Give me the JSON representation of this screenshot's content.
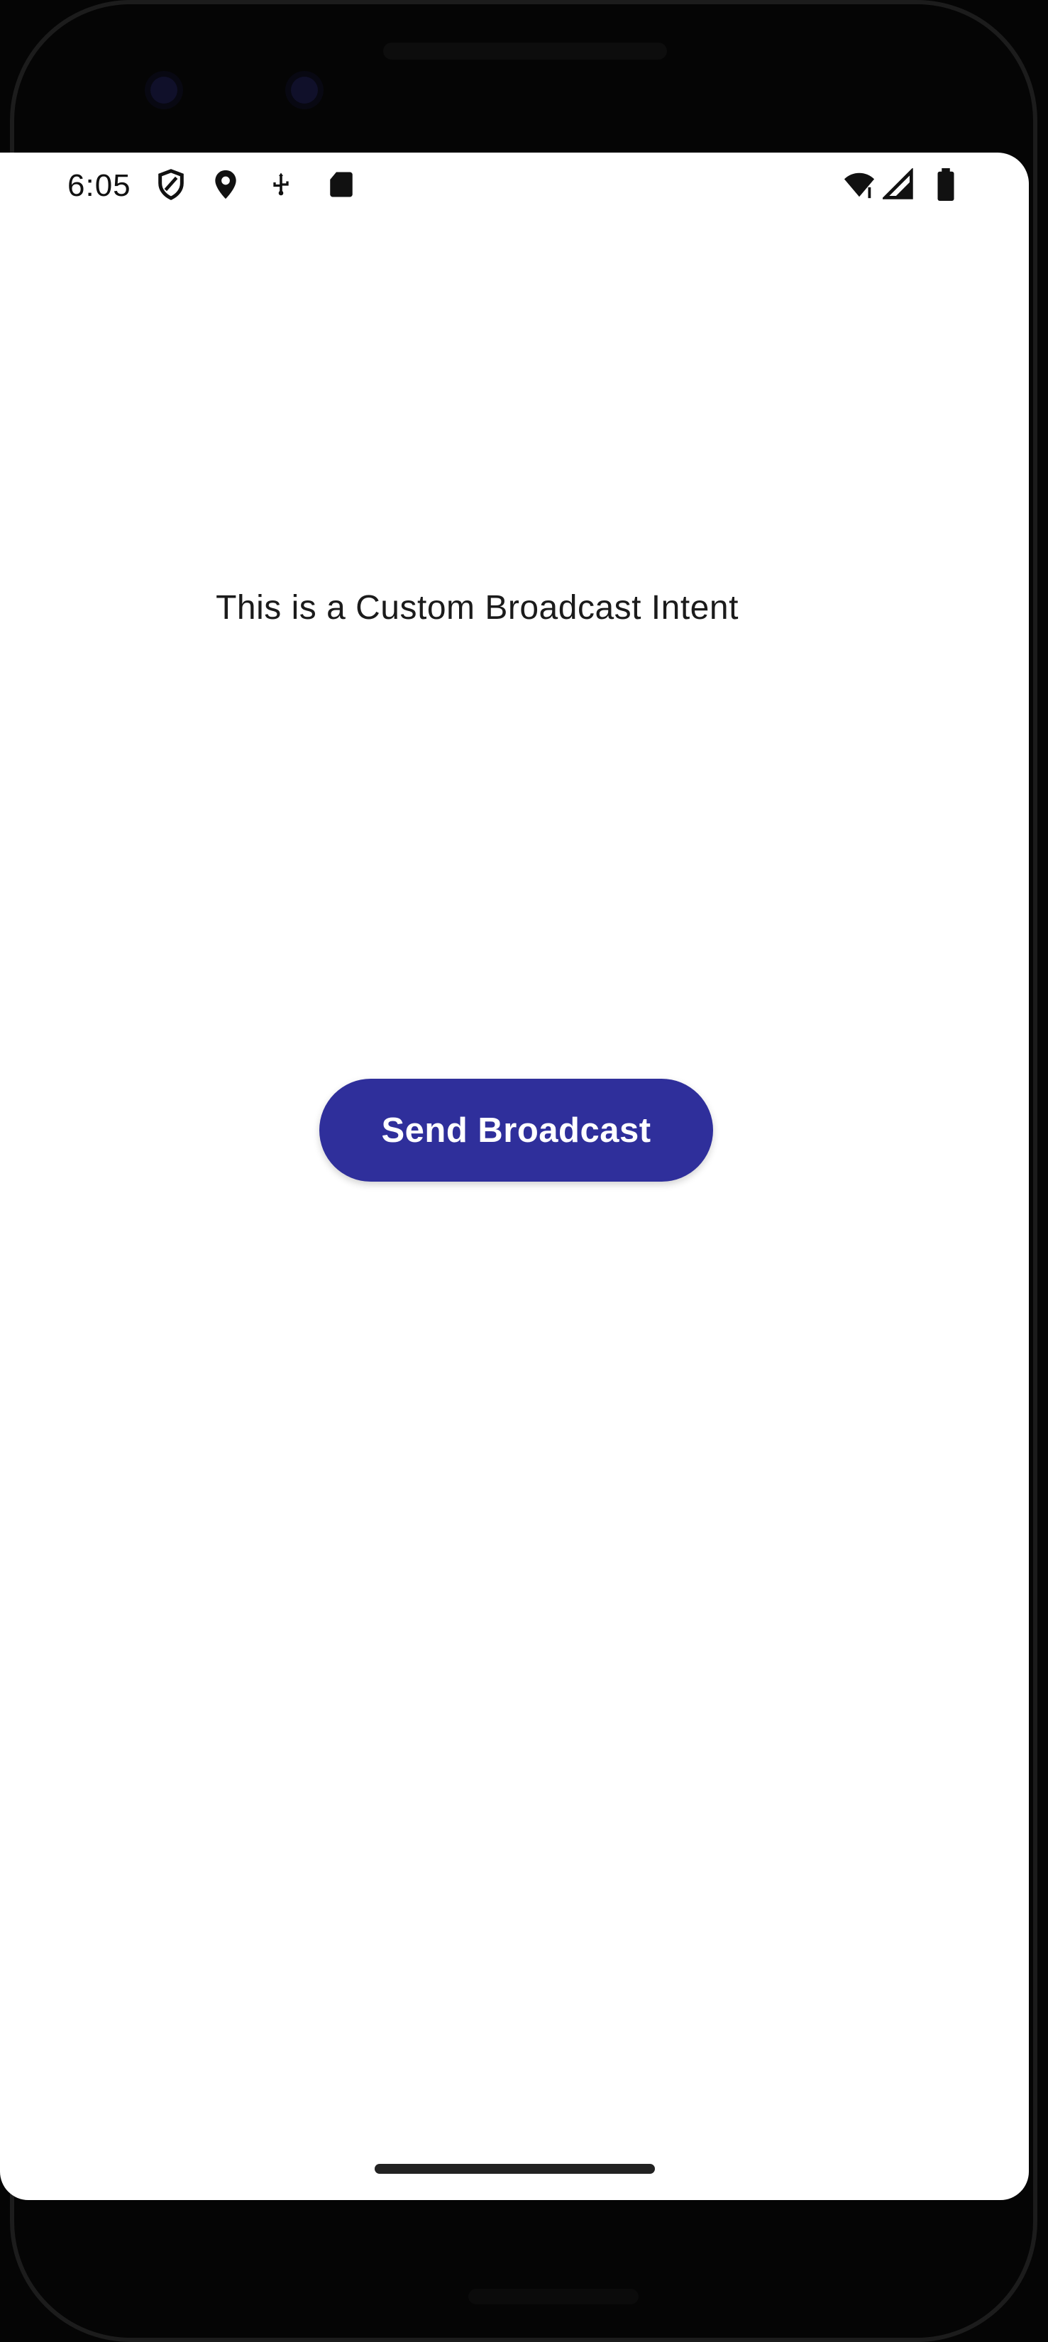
{
  "status_bar": {
    "time": "6:05",
    "icons": [
      "vpn-shield-icon",
      "location-pin-icon",
      "usb-icon",
      "sd-card-icon",
      "wifi-icon",
      "cellular-signal-icon",
      "battery-icon"
    ]
  },
  "main": {
    "message": "This is a Custom Broadcast Intent",
    "button_label": "Send Broadcast"
  },
  "colors": {
    "button_background": "#2f2f9b",
    "button_text": "#ffffff",
    "screen_background": "#ffffff",
    "text": "#1b1b1b"
  }
}
